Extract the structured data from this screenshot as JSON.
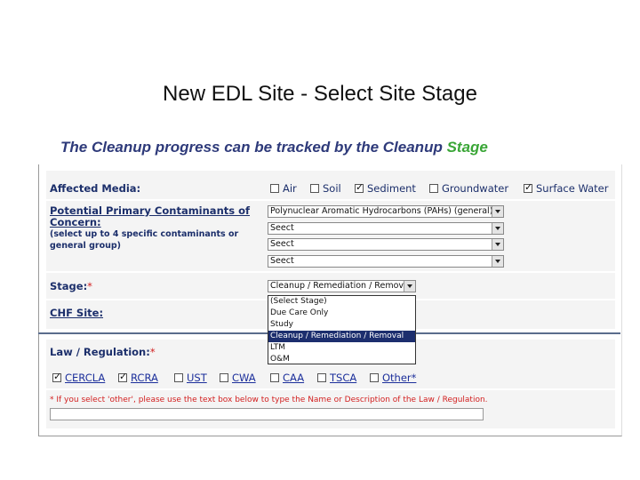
{
  "title": "New EDL Site - Select Site Stage",
  "subtitle": {
    "text": "The Cleanup progress can be tracked by the Cleanup ",
    "accent": "Stage"
  },
  "affected_media": {
    "label": "Affected Media:",
    "options": [
      {
        "label": "Air",
        "checked": false
      },
      {
        "label": "Soil",
        "checked": false
      },
      {
        "label": "Sediment",
        "checked": true
      },
      {
        "label": "Groundwater",
        "checked": false
      },
      {
        "label": "Surface Water",
        "checked": true
      }
    ]
  },
  "contaminants": {
    "label_line1": "Potential Primary Contaminants of",
    "label_line2": "Concern:",
    "note_line1": "(select up to 4 specific contaminants or",
    "note_line2": "general group)",
    "selects": [
      "Polynuclear Aromatic Hydrocarbons (PAHs) (general)",
      "Seect",
      "Seect",
      "Seect"
    ]
  },
  "stage": {
    "label": "Stage:",
    "required": "*",
    "selected": "Cleanup / Remediation / Removal",
    "options": [
      "(Select Stage)",
      "Due Care Only",
      "Study",
      "Cleanup / Remediation / Removal",
      "LTM",
      "O&M"
    ],
    "highlighted_index": 3
  },
  "chf_site": {
    "label": "CHF Site:"
  },
  "law": {
    "label": "Law / Regulation:",
    "required": "*",
    "options": [
      {
        "label": "CERCLA",
        "checked": true
      },
      {
        "label": "RCRA",
        "checked": true
      },
      {
        "label": "UST",
        "checked": false
      },
      {
        "label": "CWA",
        "checked": false
      },
      {
        "label": "CAA",
        "checked": false
      },
      {
        "label": "TSCA",
        "checked": false
      },
      {
        "label": "Other*",
        "checked": false
      }
    ],
    "note": "* If you select 'other', please use the text box below to type the Name or Description of the Law / Regulation."
  },
  "colors": {
    "accent": "#3aa637",
    "label": "#1c2f6b",
    "required": "#d21f1f",
    "highlight": "#1c2e6e"
  }
}
